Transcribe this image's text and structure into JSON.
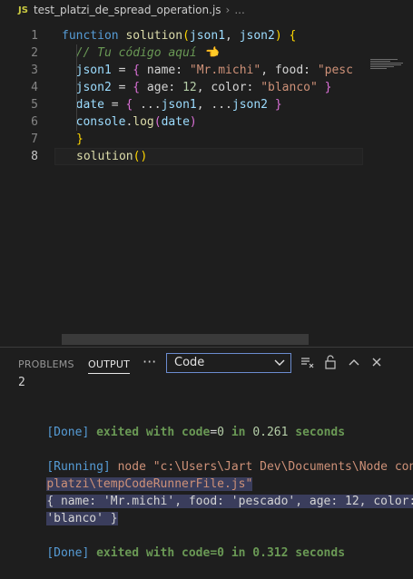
{
  "breadcrumb": {
    "lang_badge": "JS",
    "file": "test_platzi_de_spread_operation.js",
    "sep": "›",
    "more": "..."
  },
  "editor": {
    "line_numbers": [
      "1",
      "2",
      "3",
      "4",
      "5",
      "6",
      "7",
      "8"
    ],
    "active_line": "8",
    "lines": [
      [
        [
          "kw",
          "function "
        ],
        [
          "fn",
          "solution"
        ],
        [
          "br1",
          "("
        ],
        [
          "var",
          "json1"
        ],
        [
          "pun",
          ", "
        ],
        [
          "var",
          "json2"
        ],
        [
          "br1",
          ")"
        ],
        [
          "pun",
          " "
        ],
        [
          "br1",
          "{"
        ]
      ],
      [
        [
          "cm",
          "  // Tu código aquí 👈"
        ]
      ],
      [
        [
          "var",
          "  json1"
        ],
        [
          "pun",
          " = "
        ],
        [
          "br2",
          "{"
        ],
        [
          "pun",
          " name: "
        ],
        [
          "str",
          "\"Mr.michi\""
        ],
        [
          "pun",
          ", food: "
        ],
        [
          "str",
          "\"pesc"
        ]
      ],
      [
        [
          "var",
          "  json2"
        ],
        [
          "pun",
          " = "
        ],
        [
          "br2",
          "{"
        ],
        [
          "pun",
          " age: "
        ],
        [
          "num",
          "12"
        ],
        [
          "pun",
          ", color: "
        ],
        [
          "str",
          "\"blanco\""
        ],
        [
          "pun",
          " "
        ],
        [
          "br2",
          "}"
        ]
      ],
      [
        [
          "var",
          "  date"
        ],
        [
          "pun",
          " = "
        ],
        [
          "br2",
          "{"
        ],
        [
          "pun",
          " ..."
        ],
        [
          "var",
          "json1"
        ],
        [
          "pun",
          ", ..."
        ],
        [
          "var",
          "json2"
        ],
        [
          "pun",
          " "
        ],
        [
          "br2",
          "}"
        ]
      ],
      [
        [
          "var",
          "  console"
        ],
        [
          "pun",
          "."
        ],
        [
          "fn",
          "log"
        ],
        [
          "br2",
          "("
        ],
        [
          "var",
          "date"
        ],
        [
          "br2",
          ")"
        ]
      ],
      [
        [
          "br1",
          "}"
        ]
      ],
      [
        [
          "fn",
          "solution"
        ],
        [
          "br1",
          "()"
        ]
      ]
    ]
  },
  "panel": {
    "tabs": [
      "PROBLEMS",
      "OUTPUT"
    ],
    "more_label": "···",
    "select_value": "Code",
    "icons": [
      "clear-output-icon",
      "lock-icon",
      "chevron-up-icon",
      "close-icon"
    ],
    "output": {
      "partial_first": "2",
      "done1": "[Done]",
      "done1_rest": [
        " exited with ",
        "code",
        "=",
        "0",
        " in ",
        "0.261",
        " seconds"
      ],
      "running_label": "[Running]",
      "running_cmd": " node \"c:\\Users\\Jart Dev\\Documents\\Node con",
      "running_cmd2": "platzi\\tempCodeRunnerFile.js\"",
      "result1": "{ name: 'Mr.michi', food: 'pescado', age: 12, color:",
      "result2": "'blanco' }",
      "done2": "[Done]",
      "done2_rest": " exited with code=0 in 0.312 seconds"
    }
  }
}
